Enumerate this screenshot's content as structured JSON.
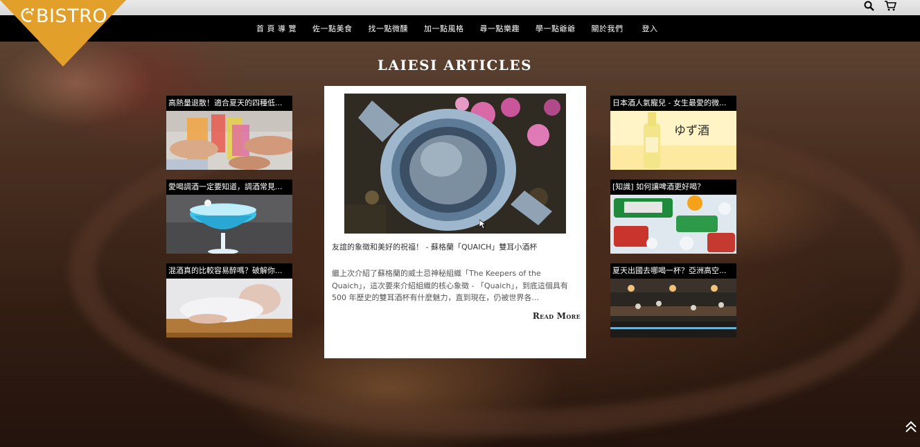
{
  "brand": {
    "logo_text": "BISTRO",
    "accent": "#e2a02a"
  },
  "top_bar": {
    "icons": [
      "search-icon",
      "cart-icon"
    ]
  },
  "nav": {
    "items": [
      "首 頁 導 覽",
      "佐一點美食",
      "找一點微醺",
      "加一點風格",
      "尋一點樂趣",
      "學一點爺爺",
      "關於我們",
      "登入"
    ]
  },
  "heading": "LAIESI ARTICLES",
  "left_cards": [
    {
      "title": "高熱量退散！適合夏天的四種低..."
    },
    {
      "title": "愛喝調酒一定要知道，調酒常見..."
    },
    {
      "title": "混酒真的比較容易醉嗎？破解你..."
    }
  ],
  "right_cards": [
    {
      "title": "日本酒人氣寵兒 - 女生最愛的微...",
      "image_text": "ゆず酒"
    },
    {
      "title": "[知識] 如何讓啤酒更好喝？"
    },
    {
      "title": "夏天出國去哪喝一杯？亞洲高空..."
    }
  ],
  "featured": {
    "title": "友誼的象徵和美好的祝福！ - 蘇格蘭「QUAICH」雙耳小酒杯",
    "body": "繼上次介紹了蘇格蘭的威士忌神秘組織「The Keepers of the Quaich」，這次要來介紹組織的核心象徵 - 「Quaich」，到底這個具有 500 年歷史的雙耳酒杯有什麼魅力，直到現在，仍被世界各...",
    "read_more": "Read More"
  },
  "scroll_top_icon": "double-chevron-up-icon"
}
